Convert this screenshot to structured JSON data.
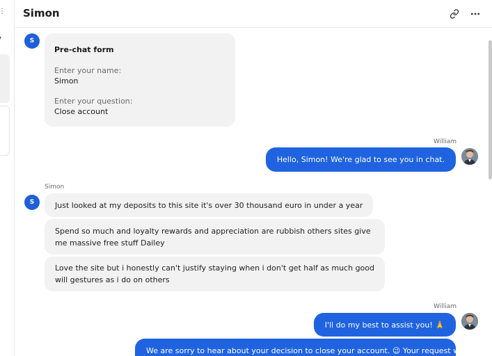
{
  "header": {
    "title": "Simon"
  },
  "form": {
    "title": "Pre-chat form",
    "fields": [
      {
        "label": "Enter your name:",
        "value": "Simon"
      },
      {
        "label": "Enter your question:",
        "value": "Close account"
      }
    ]
  },
  "avatar_initial": "S",
  "messages": {
    "agent1_sender": "William",
    "agent1_text": "Hello, Simon! We're glad to see you in chat.",
    "customer_sender": "Simon",
    "customer_msgs": [
      "Just looked at my deposits to this site it's over 30 thousand euro in under a year",
      "Spend so much and loyalty rewards and appreciation are rubbish others sites give me massive free stuff Dailey",
      "Love the site but i honestly can't justify staying when i don't get half as much good will gestures as i do on others"
    ],
    "agent2_sender": "William",
    "agent2_text": "I'll do my best to assist you! 🙏",
    "agent3_text": "We are sorry to hear about your decision to close your account. 😉 Your request will"
  },
  "colors": {
    "accent": "#1f63e0",
    "avatar": "#1f5fd8",
    "bubble_in": "#f2f2f2"
  }
}
